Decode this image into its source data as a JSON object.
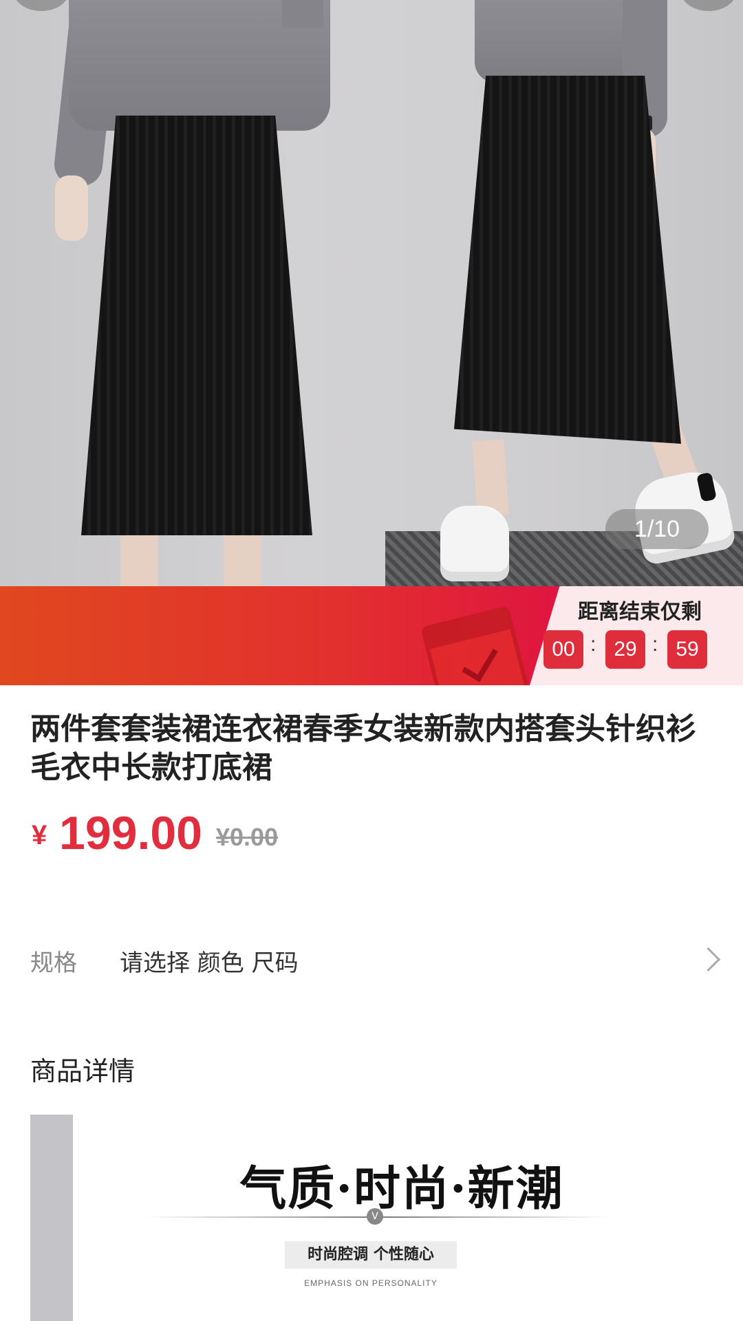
{
  "gallery": {
    "page_indicator": "1/10"
  },
  "promo": {
    "countdown_label": "距离结束仅剩",
    "hours": "00",
    "minutes": "29",
    "seconds": "59",
    "separator": ":"
  },
  "product": {
    "title": "两件套套装裙连衣裙春季女装新款内搭套头针织衫毛衣中长款打底裙",
    "currency_symbol": "¥",
    "price": "199.00",
    "original_price": "¥0.00"
  },
  "spec": {
    "label": "规格",
    "value": "请选择 颜色 尺码"
  },
  "details": {
    "section_title": "商品详情",
    "headline": "气质·时尚·新潮",
    "divider_mark": "V",
    "tagline": "时尚腔调 个性随心",
    "subline": "EMPHASIS ON PERSONALITY"
  },
  "colors": {
    "accent_red": "#e02e3f",
    "banner_start": "#e0481f",
    "banner_end": "#d90e3b",
    "countdown_bg": "#fbe9ec"
  }
}
